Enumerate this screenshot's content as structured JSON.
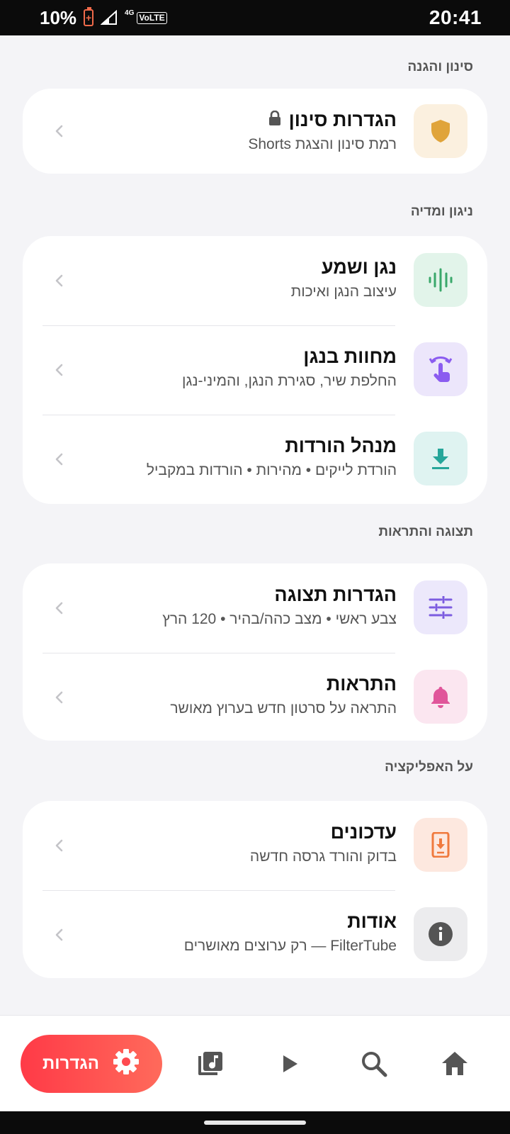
{
  "status_bar": {
    "battery_percent": "10%",
    "network": "4G",
    "volte": "VoLTE",
    "time": "20:41"
  },
  "sections": {
    "filter": {
      "header": "סינון והגנה",
      "items": [
        {
          "title": "הגדרות סינון",
          "subtitle": "רמת סינון והצגת Shorts",
          "icon": "shield-icon",
          "icon_bg": "#fbf0df",
          "icon_color": "#e0a43a",
          "locked": true
        }
      ]
    },
    "playback": {
      "header": "ניגון ומדיה",
      "items": [
        {
          "title": "נגן ושמע",
          "subtitle": "עיצוב הנגן ואיכות",
          "icon": "audio-wave-icon",
          "icon_bg": "#e2f4ea",
          "icon_color": "#3aa86b"
        },
        {
          "title": "מחוות בנגן",
          "subtitle": "החלפת שיר, סגירת הנגן, והמיני-נגן",
          "icon": "gesture-icon",
          "icon_bg": "#ece6fb",
          "icon_color": "#8b5cf0"
        },
        {
          "title": "מנהל הורדות",
          "subtitle": "הורדת לייקים • מהירות • הורדות במקביל",
          "icon": "download-icon",
          "icon_bg": "#dff3f1",
          "icon_color": "#26a69a"
        }
      ]
    },
    "display": {
      "header": "תצוגה והתראות",
      "items": [
        {
          "title": "הגדרות תצוגה",
          "subtitle": "צבע ראשי • מצב כהה/בהיר • 120 הרץ",
          "icon": "sliders-icon",
          "icon_bg": "#ece8fb",
          "icon_color": "#7c5ce0"
        },
        {
          "title": "התראות",
          "subtitle": "התראה על סרטון חדש בערוץ מאושר",
          "icon": "bell-icon",
          "icon_bg": "#fbe6f0",
          "icon_color": "#e0559a"
        }
      ]
    },
    "about": {
      "header": "על האפליקציה",
      "items": [
        {
          "title": "עדכונים",
          "subtitle": "בדוק והורד גרסה חדשה",
          "icon": "phone-update-icon",
          "icon_bg": "#fde8df",
          "icon_color": "#f07a3e"
        },
        {
          "title": "אודות",
          "subtitle": "FilterTube — רק ערוצים מאושרים",
          "icon": "info-icon",
          "icon_bg": "#ececee",
          "icon_color": "#555"
        }
      ]
    }
  },
  "bottom_nav": {
    "settings_label": "הגדרות",
    "items": [
      "home-icon",
      "search-icon",
      "play-icon",
      "music-library-icon",
      "gear-icon"
    ]
  }
}
